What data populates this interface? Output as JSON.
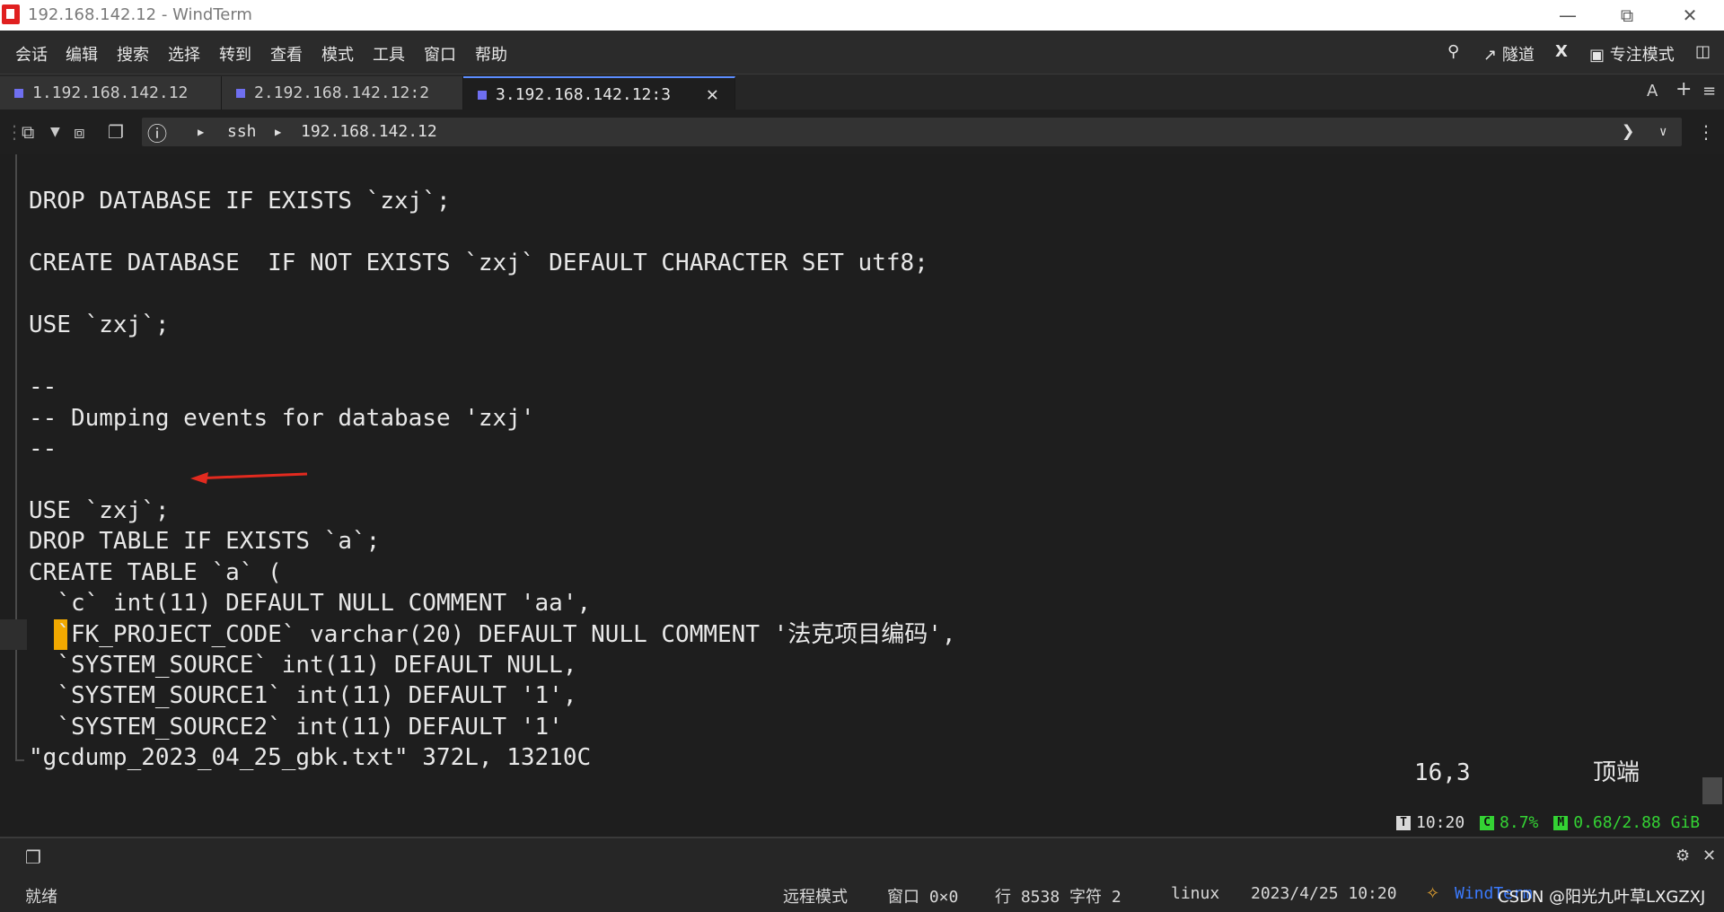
{
  "window": {
    "title": "192.168.142.12 - WindTerm",
    "minimize_icon": "minimize-icon",
    "maximize_icon": "restore-icon",
    "close_icon": "close-icon"
  },
  "menu": {
    "items": [
      "会话",
      "编辑",
      "搜索",
      "选择",
      "转到",
      "查看",
      "模式",
      "工具",
      "窗口",
      "帮助"
    ],
    "right": {
      "tunnel_label": "隧道",
      "x_label": "X",
      "focus_label": "专注模式"
    }
  },
  "tabs": [
    {
      "label": "1.192.168.142.12",
      "active": false
    },
    {
      "label": "2.192.168.142.12:2",
      "active": false
    },
    {
      "label": "3.192.168.142.12:3",
      "active": true
    }
  ],
  "tab_tools": {
    "font_label": "A",
    "add_label": "+",
    "menu_label": "≡"
  },
  "toolbar": {
    "address": {
      "protocol": "ssh",
      "host": "192.168.142.12"
    }
  },
  "terminal": {
    "lines": [
      "DROP DATABASE IF EXISTS `zxj`;",
      "",
      "CREATE DATABASE  IF NOT EXISTS `zxj` DEFAULT CHARACTER SET utf8;",
      "",
      "USE `zxj`;",
      "",
      "--",
      "-- Dumping events for database 'zxj'",
      "--",
      "",
      "USE `zxj`;",
      "DROP TABLE IF EXISTS `a`;",
      "CREATE TABLE `a` (",
      "  `c` int(11) DEFAULT NULL COMMENT 'aa',",
      "  `FK_PROJECT_CODE` varchar(20) DEFAULT NULL COMMENT '法克项目编码',",
      "  `SYSTEM_SOURCE` int(11) DEFAULT NULL,",
      "  `SYSTEM_SOURCE1` int(11) DEFAULT '1',",
      "  `SYSTEM_SOURCE2` int(11) DEFAULT '1'",
      "\"gcdump_2023_04_25_gbk.txt\" 372L, 13210C"
    ],
    "vim_position": "16,3",
    "vim_scroll": "顶端",
    "sysinfo": {
      "time_badge": "T",
      "time": "10:20",
      "cpu_badge": "C",
      "cpu": "8.7%",
      "mem_badge": "M",
      "mem": "0.68/2.88 GiB"
    }
  },
  "statusbar": {
    "ready": "就绪",
    "mode": "远程模式",
    "window": "窗口 0×0",
    "position": "行 8538 字符 2",
    "os": "linux",
    "datetime": "2023/4/25 10:20",
    "brand": "WindTerm",
    "watermark": "CSDN @阳光九叶草LXGZXJ"
  }
}
